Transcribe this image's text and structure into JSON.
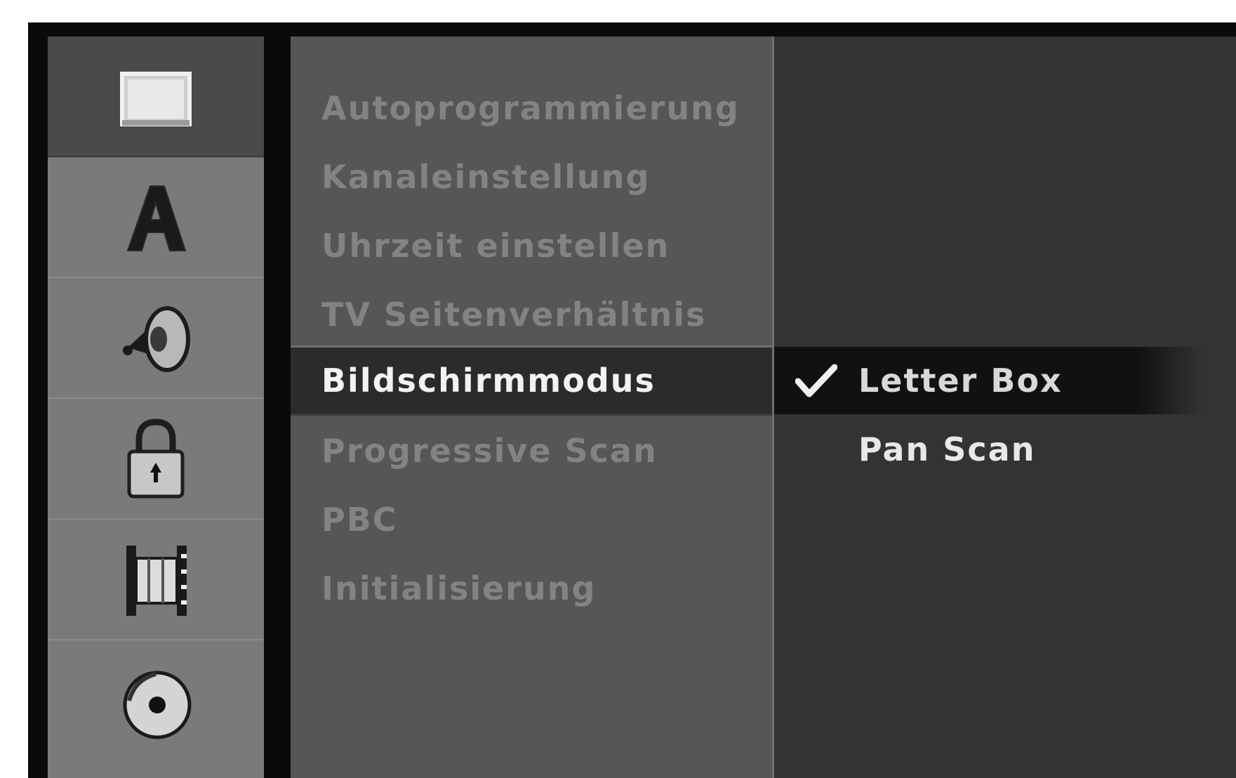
{
  "sidebar": {
    "items": [
      {
        "icon": "screen-icon",
        "active": true
      },
      {
        "icon": "language-icon",
        "active": false
      },
      {
        "icon": "speaker-icon",
        "active": false
      },
      {
        "icon": "padlock-icon",
        "active": false
      },
      {
        "icon": "film-icon",
        "active": false
      },
      {
        "icon": "disc-icon",
        "active": false
      }
    ]
  },
  "menu": {
    "items": [
      {
        "label": "Autoprogrammierung"
      },
      {
        "label": "Kanaleinstellung"
      },
      {
        "label": "Uhrzeit einstellen"
      },
      {
        "label": "TV Seitenverhältnis"
      },
      {
        "label": "Bildschirmmodus",
        "selected": true
      },
      {
        "label": "Progressive Scan"
      },
      {
        "label": "PBC"
      },
      {
        "label": "Initialisierung"
      }
    ]
  },
  "options": {
    "items": [
      {
        "label": "Letter Box",
        "checked": true
      },
      {
        "label": "Pan Scan",
        "checked": false
      }
    ]
  },
  "colors": {
    "frame": "#0a0a0a",
    "sidebar": "#7a7a7a",
    "menu": "#565656",
    "selected": "#2b2b2b",
    "options": "#333333"
  }
}
